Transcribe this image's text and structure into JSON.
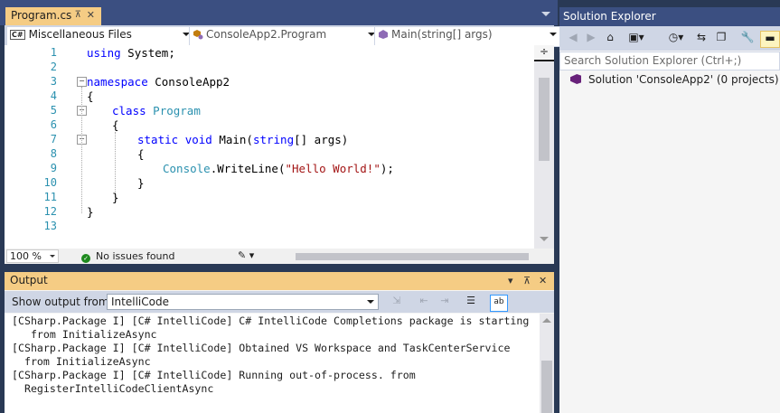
{
  "document_tab": {
    "title": "Program.cs",
    "pin": "⊼",
    "close": "✕"
  },
  "navbar": {
    "project": "Miscellaneous Files",
    "project_badge": "C#",
    "type": "ConsoleApp2.Program",
    "member": "Main(string[] args)"
  },
  "editor": {
    "line_numbers": [
      "1",
      "2",
      "3",
      "4",
      "5",
      "6",
      "7",
      "8",
      "9",
      "10",
      "11",
      "12",
      "13"
    ],
    "code": {
      "l1": {
        "kw": "using",
        "rest": " System;"
      },
      "l3": {
        "kw": "namespace",
        "rest": " ConsoleApp2"
      },
      "l4": "{",
      "l5": {
        "kw": "class",
        "type": "Program"
      },
      "l6": "{",
      "l7": {
        "kw1": "static",
        "kw2": "void",
        "name": " Main(",
        "kw3": "string",
        "rest": "[] args)"
      },
      "l8": "{",
      "l9": {
        "type": "Console",
        "method": ".WriteLine(",
        "str": "\"Hello World!\"",
        "rest": ");"
      },
      "l10": "}",
      "l11": "}",
      "l12": "}"
    },
    "split_icon": "÷"
  },
  "editor_status": {
    "zoom": "100 %",
    "issues": "No issues found",
    "issues_icon": "✓",
    "brush_icon": "✎ ▾"
  },
  "output": {
    "title": "Output",
    "controls": {
      "dropdown": "▾",
      "pin": "⊼",
      "close": "✕"
    },
    "show_from_label": "Show output from:",
    "source": "IntelliCode",
    "lines": [
      "[CSharp.Package I] [C# IntelliCode] C# IntelliCode Completions package is starting",
      "   from InitializeAsync",
      "[CSharp.Package I] [C# IntelliCode] Obtained VS Workspace and TaskCenterService",
      "  from InitializeAsync",
      "[CSharp.Package I] [C# IntelliCode] Running out-of-process. from",
      "  RegisterIntelliCodeClientAsync"
    ],
    "toolbar_icons": [
      "⇲",
      "⇤",
      "⇥",
      "☰",
      "ab"
    ]
  },
  "solution_explorer": {
    "title": "Solution Explorer",
    "search_placeholder": "Search Solution Explorer (Ctrl+;)",
    "solution_node": "Solution 'ConsoleApp2' (0 projects)",
    "toolbar_icons": [
      "◀",
      "▶",
      "⌂",
      "▣▾",
      "◷▾",
      "⇆",
      "❐",
      "🔧",
      "▬"
    ]
  },
  "colors": {
    "chrome": "#293955",
    "active_tab": "#f5cc84",
    "keyword": "#0000ff",
    "type": "#2b91af",
    "string": "#a31515"
  }
}
